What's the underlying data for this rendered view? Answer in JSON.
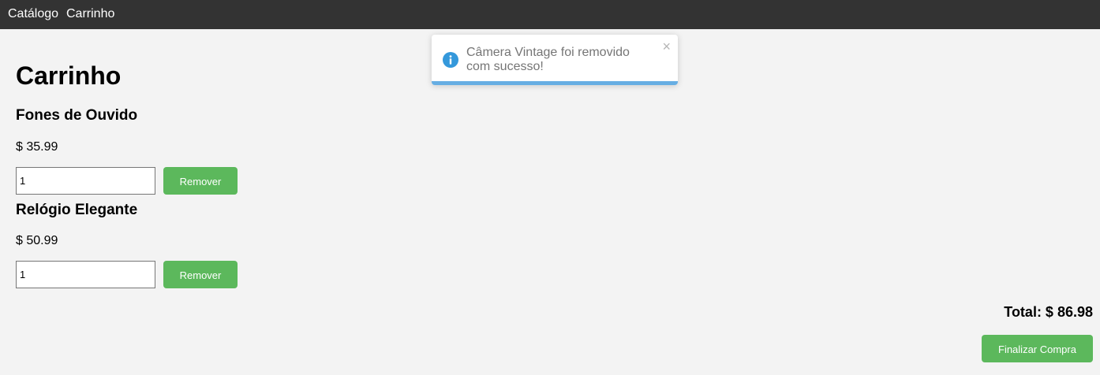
{
  "nav": {
    "items": [
      {
        "label": "Catálogo"
      },
      {
        "label": "Carrinho"
      }
    ]
  },
  "page": {
    "title": "Carrinho"
  },
  "cart": {
    "items": [
      {
        "name": "Fones de Ouvido",
        "price": "$ 35.99",
        "quantity": "1",
        "remove_label": "Remover"
      },
      {
        "name": "Relógio Elegante",
        "price": "$ 50.99",
        "quantity": "1",
        "remove_label": "Remover"
      }
    ],
    "total": "Total: $ 86.98",
    "checkout_label": "Finalizar Compra"
  },
  "toast": {
    "message": "Câmera Vintage foi removido com sucesso!",
    "close_symbol": "×",
    "icon": "info-icon",
    "progress_fraction": 1.0,
    "color": "#3498db"
  },
  "colors": {
    "navbar": "#333333",
    "background": "#f3f3f3",
    "button": "#5cb85c"
  }
}
